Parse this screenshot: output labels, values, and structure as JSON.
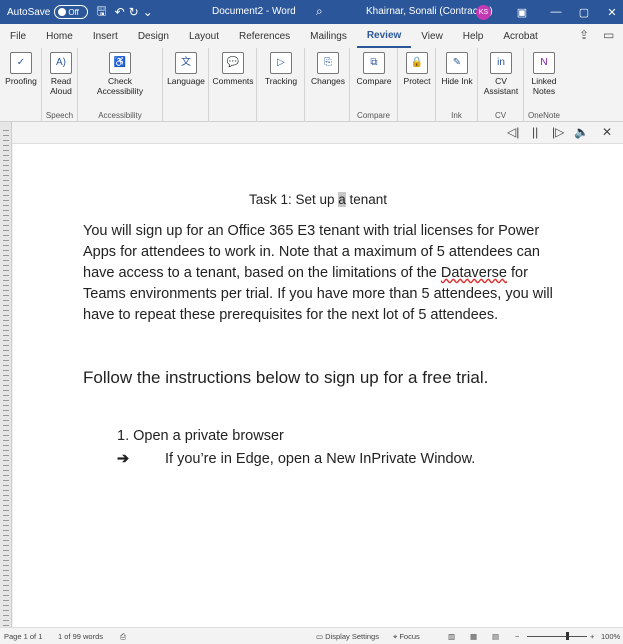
{
  "titlebar": {
    "autosave_label": "AutoSave",
    "autosave_state": "Off",
    "doc_title": "Document2 - Word",
    "user": "Khairnar, Sonali (Contractor)",
    "initials": "KS"
  },
  "tabs": [
    "File",
    "Home",
    "Insert",
    "Design",
    "Layout",
    "References",
    "Mailings",
    "Review",
    "View",
    "Help",
    "Acrobat"
  ],
  "active_tab": "Review",
  "ribbon": {
    "proofing": "Proofing",
    "read_aloud": "Read Aloud",
    "speech": "Speech",
    "check_accessibility": "Check Accessibility",
    "accessibility": "Accessibility",
    "language": "Language",
    "comments": "Comments",
    "tracking": "Tracking",
    "changes": "Changes",
    "compare": "Compare",
    "compare_group": "Compare",
    "protect": "Protect",
    "hide_ink": "Hide Ink",
    "ink": "Ink",
    "cv_assistant": "CV Assistant",
    "cv": "CV",
    "linked_notes": "Linked Notes",
    "onenote": "OneNote"
  },
  "document": {
    "heading_before": "Task 1: Set up ",
    "heading_sel": "a",
    "heading_after": " tenant",
    "para1_before": "You will sign up for an Office 365 E3 tenant with trial licenses for Power Apps for attendees to work in. Note that a maximum of 5 attendees can have access to a tenant, based on the limitations of the ",
    "para1_link": "Dataverse",
    "para1_after": " for Teams environments per trial. If you have more than 5 attendees, you will have to repeat these prerequisites for the next lot of 5 attendees.",
    "para2": "Follow the instructions below to sign up for a free trial.",
    "step1": "1. Open a private browser",
    "arrow": "➔",
    "step1_sub": "If you’re in Edge, open a New InPrivate Window."
  },
  "statusbar": {
    "page": "Page 1 of 1",
    "words": "1 of 99 words",
    "display_settings": "Display Settings",
    "focus": "Focus",
    "zoom": "100%"
  }
}
